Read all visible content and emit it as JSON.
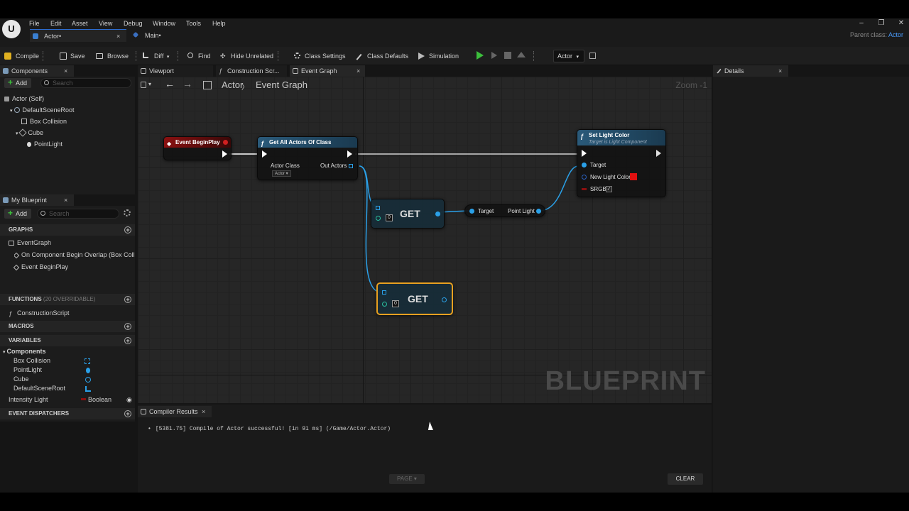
{
  "app": {
    "logo": "U",
    "menu": [
      "File",
      "Edit",
      "Asset",
      "View",
      "Debug",
      "Window",
      "Tools",
      "Help"
    ],
    "window_controls": [
      "–",
      "❐",
      "✕"
    ],
    "tabs": [
      {
        "label": "Actor•",
        "close": "×"
      },
      {
        "label": "Main•"
      }
    ],
    "parent_class_label": "Parent class:",
    "parent_class_value": "Actor"
  },
  "toolbar": {
    "compile": "Compile",
    "save": "Save",
    "browse": "Browse",
    "diff": "Diff",
    "find": "Find",
    "hide_unrelated": "Hide Unrelated",
    "class_settings": "Class Settings",
    "class_defaults": "Class Defaults",
    "simulation": "Simulation",
    "debug_object": "Actor"
  },
  "components_panel": {
    "title": "Components",
    "add": "Add",
    "search_placeholder": "Search",
    "items": [
      {
        "label": "Actor (Self)"
      },
      {
        "label": "DefaultSceneRoot"
      },
      {
        "label": "Box Collision"
      },
      {
        "label": "Cube"
      },
      {
        "label": "PointLight"
      }
    ]
  },
  "my_blueprint": {
    "title": "My Blueprint",
    "add": "Add",
    "search_placeholder": "Search",
    "graphs_header": "GRAPHS",
    "graphs": [
      "EventGraph",
      "On Component Begin Overlap (Box Collisi",
      "Event BeginPlay"
    ],
    "functions_header": "FUNCTIONS",
    "functions_sub": "(20 OVERRIDABLE)",
    "functions": [
      "ConstructionScript"
    ],
    "macros_header": "MACROS",
    "variables_header": "VARIABLES",
    "components_group": "Components",
    "component_vars": [
      "Box Collision",
      "PointLight",
      "Cube",
      "DefaultSceneRoot"
    ],
    "intensity_var": "Intensity Light",
    "intensity_type": "Boolean",
    "dispatchers_header": "EVENT DISPATCHERS"
  },
  "editor_tabs": {
    "viewport": "Viewport",
    "construction": "Construction Scr...",
    "event_graph": "Event Graph"
  },
  "graph": {
    "breadcrumb_root": "Actor",
    "breadcrumb_sep": "〉",
    "breadcrumb_leaf": "Event Graph",
    "zoom": "Zoom -1",
    "watermark": "BLUEPRINT",
    "nodes": {
      "begin_play": {
        "title": "Event BeginPlay"
      },
      "get_all": {
        "title": "Get All Actors Of Class",
        "pin_actor_class": "Actor Class",
        "pin_out_actors": "Out Actors",
        "class_value": "Actor"
      },
      "get1": {
        "label": "GET",
        "index": "0"
      },
      "get2": {
        "label": "GET",
        "index": "0"
      },
      "cast": {
        "pin_target": "Target",
        "pin_point_light": "Point Light"
      },
      "set_light": {
        "title": "Set Light Color",
        "subtitle": "Target is Light Component",
        "pin_target": "Target",
        "pin_color": "New Light Color",
        "pin_srgb": "SRGB"
      }
    }
  },
  "details": {
    "title": "Details"
  },
  "compiler": {
    "title": "Compiler Results",
    "message": "[5381.75] Compile of Actor successful! [in 91 ms] (/Game/Actor.Actor)",
    "page": "PAGE",
    "clear": "CLEAR"
  },
  "colors": {
    "accent": "#2c6cd0",
    "exec_wire": "#ffffff",
    "object_wire": "#2aa0e8",
    "event_header": "#8a1010",
    "function_header": "#2a5a7a",
    "selected_outline": "#e8a020",
    "color_swatch": "#e01010"
  }
}
